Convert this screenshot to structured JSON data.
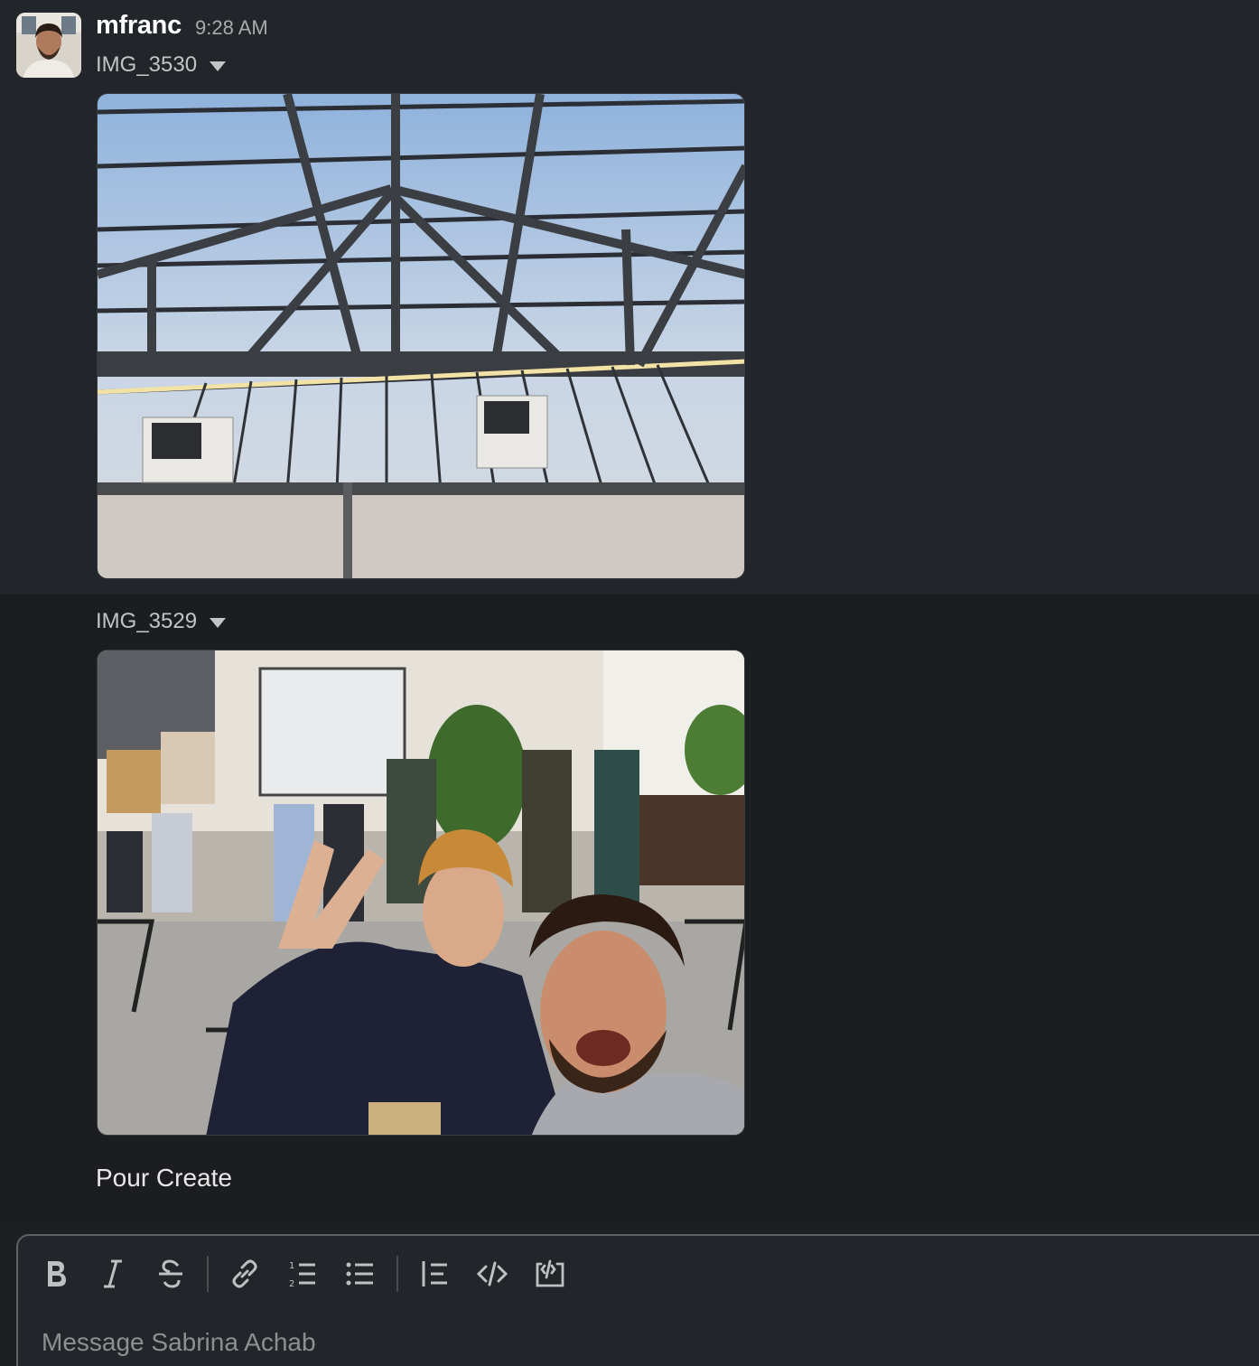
{
  "message": {
    "author": "mfranc",
    "time": "9:28 AM",
    "caption": "Pour Create"
  },
  "attachments": [
    {
      "file_name": "IMG_3530",
      "subject": "glass-roof-photo"
    },
    {
      "file_name": "IMG_3529",
      "subject": "selfie-event-photo"
    }
  ],
  "composer": {
    "placeholder": "Message Sabrina Achab",
    "toolbar": [
      "bold-icon",
      "italic-icon",
      "strikethrough-icon",
      "link-icon",
      "ordered-list-icon",
      "bulleted-list-icon",
      "blockquote-icon",
      "code-icon",
      "code-block-icon"
    ]
  },
  "colors": {
    "background": "#1e1f23",
    "highlight_row": "#222529",
    "text_primary": "#ffffff",
    "text_muted": "#a9aaac"
  }
}
